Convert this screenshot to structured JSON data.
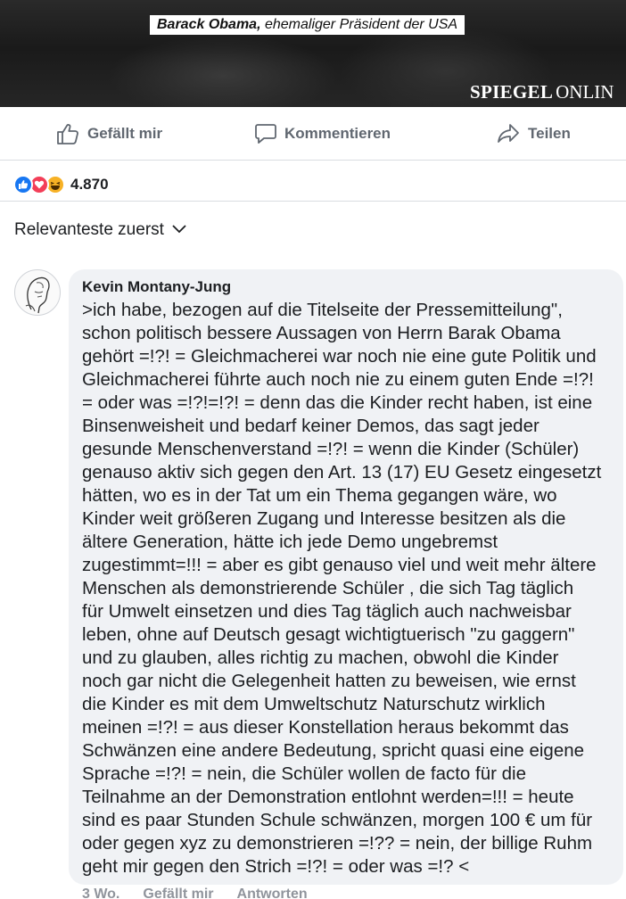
{
  "banner": {
    "caption_name": "Barack Obama,",
    "caption_rest": "ehemaliger Präsident der USA",
    "brand_bold": "SPIEGEL",
    "brand_light": "ONLIN"
  },
  "actions": {
    "like_label": "Gefällt mir",
    "comment_label": "Kommentieren",
    "share_label": "Teilen"
  },
  "reactions": {
    "icons": [
      "like-icon",
      "love-icon",
      "haha-icon"
    ],
    "count": "4.870"
  },
  "sort": {
    "label": "Relevanteste zuerst"
  },
  "comment": {
    "author": "Kevin Montany-Jung",
    "lines": [
      ">ich habe, bezogen auf die Titelseite der Pressemitteilung\",",
      "schon politisch bessere Aussagen von Herrn Barak Obama",
      "gehört =!?! = Gleichmacherei war noch nie eine gute Politik und",
      "Gleichmacherei führte auch noch nie zu einem guten Ende =!?!",
      "= oder was =!?!=!?! = denn das die Kinder recht haben, ist eine",
      "Binsenweisheit und bedarf keiner Demos, das sagt jeder",
      "gesunde Menschenverstand =!?! = wenn die Kinder (Schüler)",
      "genauso aktiv sich gegen den Art. 13 (17) EU Gesetz eingesetzt",
      "hätten, wo es in der Tat um ein Thema gegangen wäre, wo",
      "Kinder weit größeren Zugang und Interesse besitzen als die",
      "ältere Generation, hätte ich jede Demo ungebremst",
      "zugestimmt=!!! = aber es gibt genauso viel und weit mehr ältere",
      "Menschen als demonstrierende Schüler , die sich Tag täglich",
      "für Umwelt einsetzen und dies Tag täglich auch nachweisbar",
      "leben, ohne auf Deutsch gesagt wichtigtuerisch \"zu gaggern\"",
      "und zu glauben, alles richtig zu machen, obwohl die Kinder",
      "noch gar nicht die Gelegenheit hatten zu beweisen, wie ernst",
      "die Kinder es mit dem Umweltschutz Naturschutz wirklich",
      "meinen =!?! = aus dieser Konstellation heraus bekommt das",
      "Schwänzen eine andere Bedeutung, spricht quasi eine eigene",
      "Sprache =!?! = nein, die Schüler wollen de facto für die",
      "Teilnahme an der Demonstration entlohnt werden=!!! = heute",
      "sind  es paar Stunden Schule schwänzen, morgen 100 € um für",
      "oder gegen xyz zu demonstrieren =!?? = nein, der billige Ruhm",
      "geht mir gegen den Strich =!?! = oder was =!? <"
    ],
    "meta_time": "3 Wo.",
    "meta_like": "Gefällt mir",
    "meta_reply": "Antworten"
  },
  "colors": {
    "like_blue": "#1877f2",
    "love_red": "#f33e58",
    "haha_yellow": "#f7b125",
    "bubble_bg": "#f0f2f5",
    "secondary_text": "#606770"
  }
}
